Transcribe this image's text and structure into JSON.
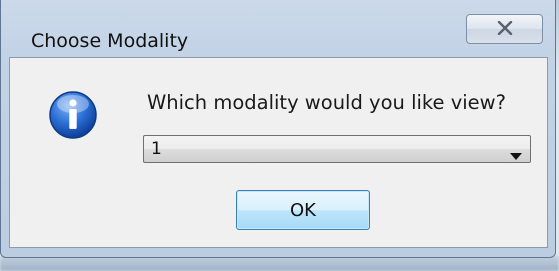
{
  "window": {
    "title": "Choose Modality"
  },
  "dialog": {
    "prompt": "Which modality would you like view?",
    "select": {
      "selected_value": "1"
    },
    "ok_label": "OK"
  },
  "icons": {
    "close": "close-icon",
    "info": "info-icon",
    "dropdown": "chevron-down-icon"
  },
  "colors": {
    "ok_button_border": "#3c7fb1",
    "info_icon_blue": "#1c5bbd"
  }
}
